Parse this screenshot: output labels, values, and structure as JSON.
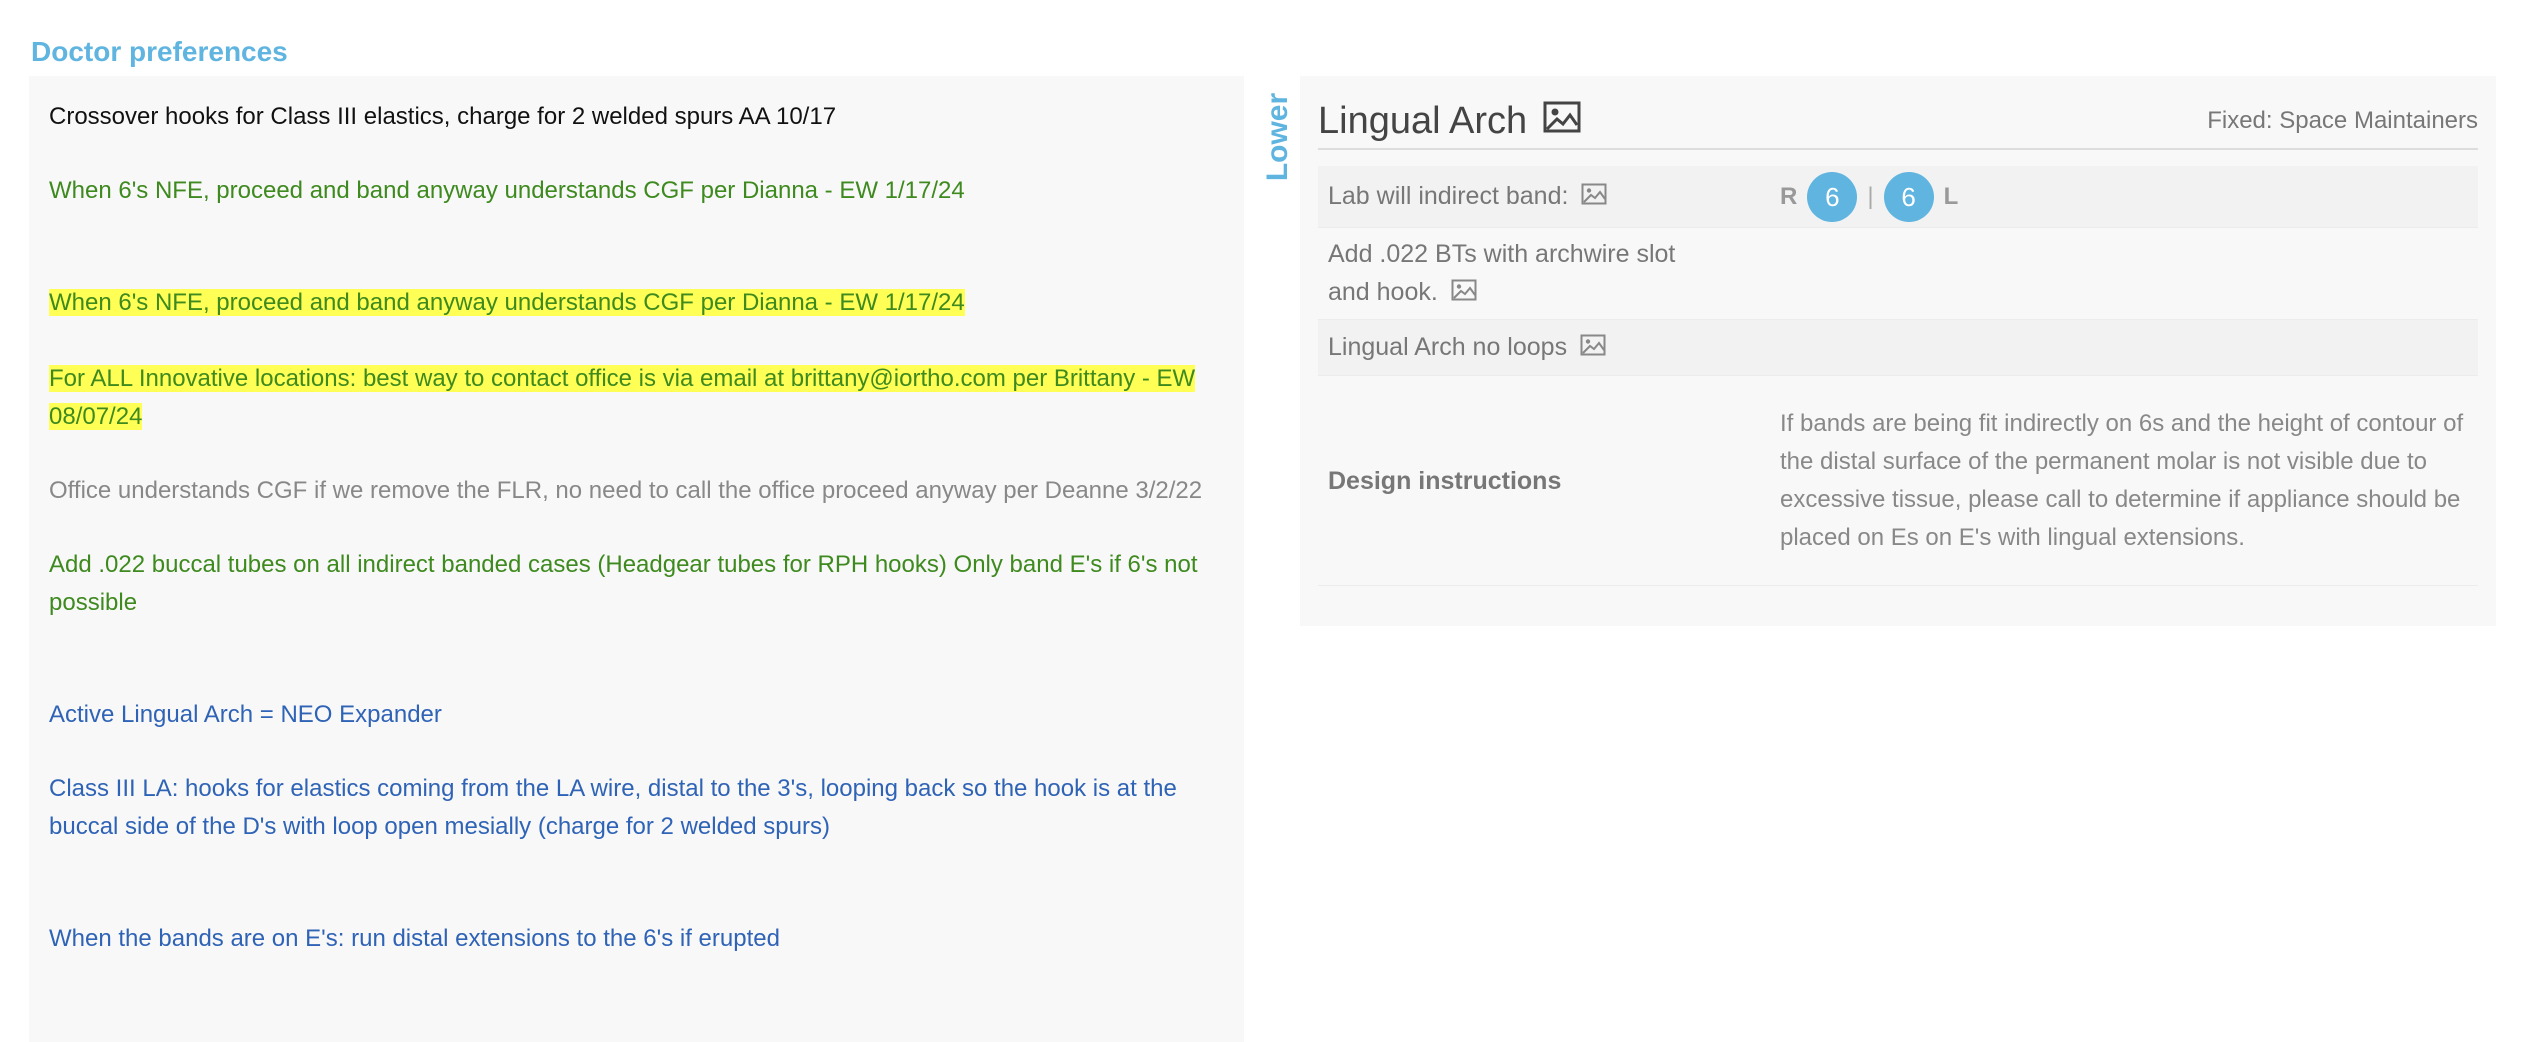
{
  "section_title": "Doctor preferences",
  "preferences": [
    {
      "text": "Crossover hooks for Class III elastics, charge for 2 welded spurs AA 10/17",
      "color": "#111111",
      "highlight": false
    },
    {
      "text": "When 6's NFE, proceed and band anyway understands CGF per Dianna - EW 1/17/24",
      "color": "#3e8a1f",
      "highlight": false
    },
    {
      "text": "When 6's NFE, proceed and band anyway understands CGF per Dianna - EW 1/17/24",
      "color": "#3e8a1f",
      "highlight": true
    },
    {
      "text": "For ALL Innovative locations: best way to contact office is via email at brittany@iortho.com per Brittany - EW 08/07/24",
      "color": "#3e8a1f",
      "highlight": true
    },
    {
      "text": "Office understands CGF if we remove the FLR, no need to call the office proceed anyway per Deanne 3/2/22",
      "color": "#888888",
      "highlight": false
    },
    {
      "text": "Add .022 buccal tubes on all indirect banded cases (Headgear tubes for RPH hooks) Only band E's if 6's not possible",
      "color": "#3e8a1f",
      "highlight": false
    },
    {
      "text": "Active Lingual Arch = NEO Expander",
      "color": "#2f63b6",
      "highlight": false
    },
    {
      "text": "Class III LA: hooks for elastics coming from the LA wire, distal to the 3's, looping back so the hook is at the buccal side of the D's with loop open mesially (charge for 2 welded spurs)",
      "color": "#2f63b6",
      "highlight": false
    },
    {
      "text": "When the bands are on E's: run distal extensions to the 6's if erupted",
      "color": "#2f63b6",
      "highlight": false
    }
  ],
  "arch_label": "Lower",
  "appliance": {
    "title": "Lingual Arch",
    "title_icon": "image-icon",
    "category": "Fixed: Space Maintainers",
    "rows": [
      {
        "label": "Lab will indirect band:",
        "icon": "image-icon"
      },
      {
        "label": "Add .022 BTs with archwire slot and hook.",
        "icon": "image-icon"
      },
      {
        "label": "Lingual Arch no loops",
        "icon": "image-icon"
      }
    ],
    "teeth": {
      "right_label": "R",
      "right_tooth": "6",
      "separator": "|",
      "left_tooth": "6",
      "left_label": "L"
    },
    "design_label": "Design instructions",
    "design_text": "If bands are being fit indirectly on 6s and the height of contour of the distal surface of the permanent molar is not visible due to excessive tissue, please call to determine if appliance should be placed on Es on E's with lingual extensions."
  },
  "colors": {
    "accent": "#5fb4e0",
    "tooth_badge": "#5fb4e0",
    "highlight": "#ffff55"
  }
}
